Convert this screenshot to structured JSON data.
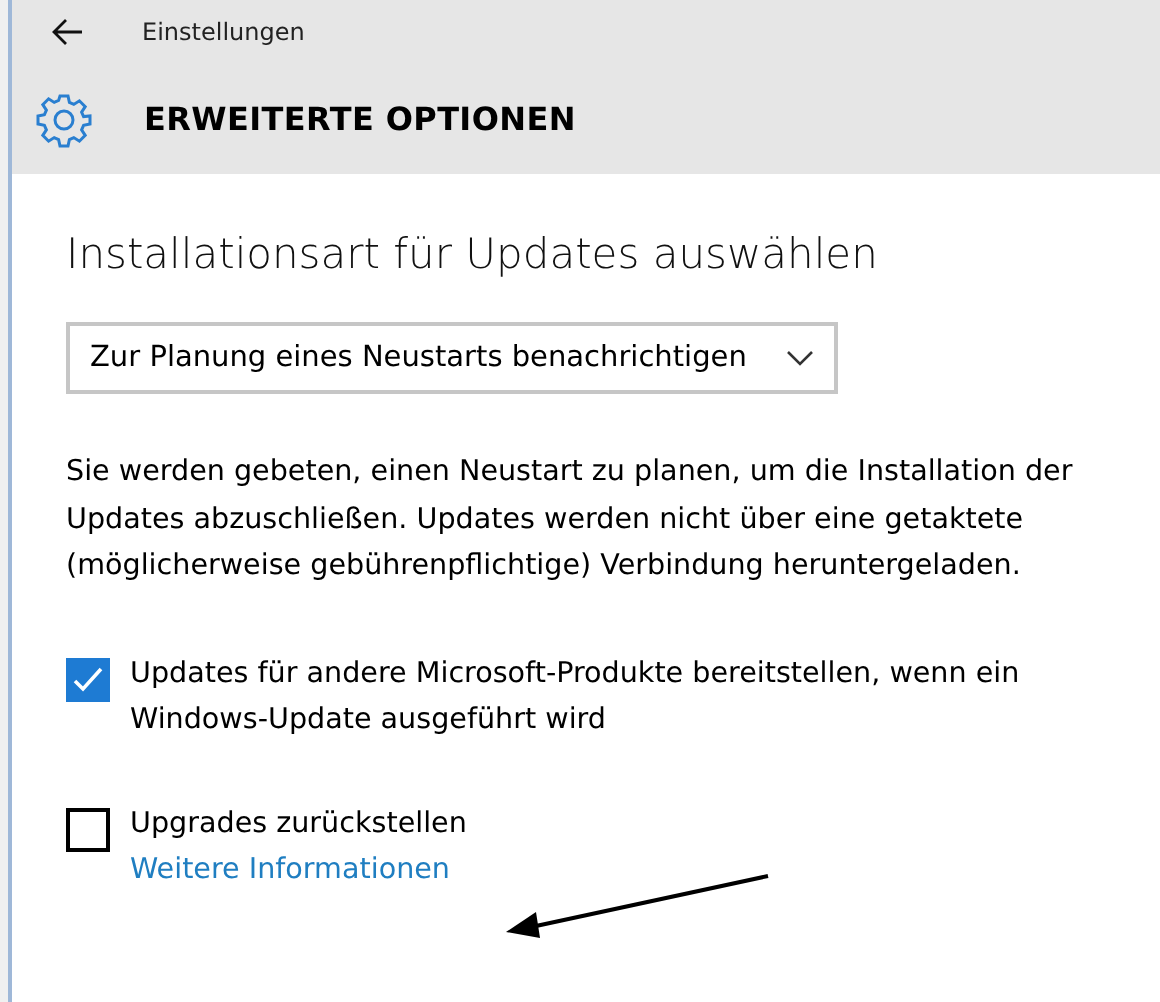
{
  "window": {
    "title": "Einstellungen"
  },
  "page": {
    "title": "ERWEITERTE OPTIONEN"
  },
  "section": {
    "heading": "Installationsart für Updates auswählen",
    "dropdown": {
      "value": "Zur Planung eines Neustarts benachrichtigen"
    },
    "description": "Sie werden gebeten, einen Neustart zu planen, um die Installation der Updates abzuschließen. Updates werden nicht über eine getaktete (möglicherweise gebührenpflichtige) Verbindung heruntergeladen."
  },
  "options": [
    {
      "label": "Updates für andere Microsoft-Produkte bereitstellen, wenn ein Windows-Update ausgeführt wird",
      "checked": true
    },
    {
      "label": "Upgrades zurückstellen",
      "checked": false,
      "link": "Weitere Informationen"
    }
  ]
}
